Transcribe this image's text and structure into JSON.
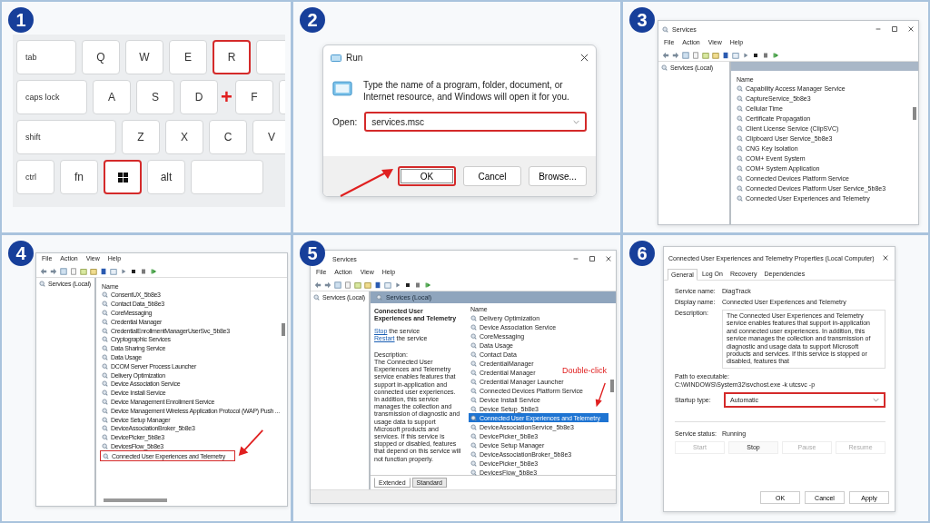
{
  "steps": [
    {
      "number": "1",
      "kind": "keyboard",
      "rows": [
        [
          {
            "label": "tab",
            "kind": "modifier",
            "highlighted": false
          },
          {
            "label": "Q",
            "kind": "letter",
            "highlighted": false
          },
          {
            "label": "W",
            "kind": "letter",
            "highlighted": false
          },
          {
            "label": "E",
            "kind": "letter",
            "highlighted": false
          },
          {
            "label": "R",
            "kind": "letter",
            "highlighted": true
          },
          {
            "kind": "blank",
            "highlighted": false
          }
        ],
        [
          {
            "label": "caps lock",
            "kind": "modifier",
            "highlighted": false
          },
          {
            "label": "A",
            "kind": "letter",
            "highlighted": false
          },
          {
            "label": "S",
            "kind": "letter",
            "highlighted": false
          },
          {
            "label": "D",
            "kind": "letter",
            "highlighted": false
          },
          {
            "label": "+",
            "kind": "plus"
          },
          {
            "label": "F",
            "kind": "letter",
            "highlighted": false
          },
          {
            "kind": "blank",
            "highlighted": false
          }
        ],
        [
          {
            "label": "shift",
            "kind": "modifier",
            "highlighted": false
          },
          {
            "label": "Z",
            "kind": "letter",
            "highlighted": false
          },
          {
            "label": "X",
            "kind": "letter",
            "highlighted": false
          },
          {
            "label": "C",
            "kind": "letter",
            "highlighted": false
          },
          {
            "label": "V",
            "kind": "letter",
            "highlighted": false
          }
        ],
        [
          {
            "label": "ctrl",
            "kind": "modifier",
            "highlighted": false
          },
          {
            "label": "fn",
            "kind": "letter",
            "highlighted": false
          },
          {
            "kind": "windows",
            "highlighted": true
          },
          {
            "label": "alt",
            "kind": "letter",
            "highlighted": false
          },
          {
            "kind": "blank",
            "highlighted": false
          }
        ]
      ]
    },
    {
      "number": "2",
      "kind": "run",
      "title": "Run",
      "prompt": "Type the name of a program, folder, document, or Internet resource, and Windows will open it for you.",
      "open_label": "Open:",
      "value": "services.msc",
      "field_highlighted": true,
      "buttons": [
        {
          "label": "OK",
          "highlighted": true
        },
        {
          "label": "Cancel",
          "highlighted": false
        },
        {
          "label": "Browse...",
          "highlighted": false
        }
      ]
    },
    {
      "number": "3",
      "kind": "services",
      "title": "Services",
      "menu": [
        "File",
        "Action",
        "View",
        "Help"
      ],
      "tree": "Services (Local)",
      "column": "Name",
      "rows": [
        {
          "name": "Capability Access Manager Service",
          "highlighted": false
        },
        {
          "name": "CaptureService_5b8e3",
          "highlighted": false
        },
        {
          "name": "Cellular Time",
          "highlighted": false
        },
        {
          "name": "Certificate Propagation",
          "highlighted": false
        },
        {
          "name": "Client License Service (ClipSVC)",
          "highlighted": false
        },
        {
          "name": "Clipboard User Service_5b8e3",
          "highlighted": false
        },
        {
          "name": "CNG Key Isolation",
          "highlighted": false
        },
        {
          "name": "COM+ Event System",
          "highlighted": false
        },
        {
          "name": "COM+ System Application",
          "highlighted": false
        },
        {
          "name": "Connected Devices Platform Service",
          "highlighted": false
        },
        {
          "name": "Connected Devices Platform User Service_5b8e3",
          "highlighted": false
        },
        {
          "name": "Connected User Experiences and Telemetry",
          "highlighted": false
        }
      ]
    },
    {
      "number": "4",
      "kind": "services",
      "menu": [
        "File",
        "Action",
        "View",
        "Help"
      ],
      "tree": "Services (Local)",
      "column": "Name",
      "rows": [
        {
          "name": "ConsentUX_5b8e3",
          "highlighted": false
        },
        {
          "name": "Contact Data_5b8e3",
          "highlighted": false
        },
        {
          "name": "CoreMessaging",
          "highlighted": false
        },
        {
          "name": "Credential Manager",
          "highlighted": false
        },
        {
          "name": "CredentialEnrollmentManagerUserSvc_5b8e3",
          "highlighted": false
        },
        {
          "name": "Cryptographic Services",
          "highlighted": false
        },
        {
          "name": "Data Sharing Service",
          "highlighted": false
        },
        {
          "name": "Data Usage",
          "highlighted": false
        },
        {
          "name": "DCOM Server Process Launcher",
          "highlighted": false
        },
        {
          "name": "Delivery Optimization",
          "highlighted": false
        },
        {
          "name": "Device Association Service",
          "highlighted": false
        },
        {
          "name": "Device Install Service",
          "highlighted": false
        },
        {
          "name": "Device Management Enrollment Service",
          "highlighted": false
        },
        {
          "name": "Device Management Wireless Application Protocol (WAP) Push ...",
          "highlighted": false
        },
        {
          "name": "Device Setup Manager",
          "highlighted": false
        },
        {
          "name": "DeviceAssociationBroker_5b8e3",
          "highlighted": false
        },
        {
          "name": "DevicePicker_5b8e3",
          "highlighted": false
        },
        {
          "name": "DevicesFlow_5b8e3",
          "highlighted": false
        },
        {
          "name": "Connected User Experiences and Telemetry",
          "highlighted": true
        }
      ]
    },
    {
      "number": "5",
      "kind": "services_detail",
      "title": "Services",
      "menu": [
        "File",
        "Action",
        "View",
        "Help"
      ],
      "tree": "Services (Local)",
      "header": "Services (Local)",
      "service_title": "Connected User Experiences and Telemetry",
      "actions": [
        {
          "link": "Stop",
          "text": "the service"
        },
        {
          "link": "Restart",
          "text": "the service"
        }
      ],
      "description_label": "Description:",
      "description": "The Connected User Experiences and Telemetry service enables features that support in-application and connected user experiences. In addition, this service manages the collection and transmission of diagnostic and usage data to support Microsoft products and services. If this service is stopped or disabled, features that depend on this service will not function properly.",
      "column": "Name",
      "annotation": "Double-click",
      "rows": [
        {
          "name": "Delivery Optimization",
          "selected": false
        },
        {
          "name": "Device Association Service",
          "selected": false
        },
        {
          "name": "CoreMessaging",
          "selected": false
        },
        {
          "name": "Data Usage",
          "selected": false
        },
        {
          "name": "Contact Data",
          "selected": false
        },
        {
          "name": "CredentialManager",
          "selected": false
        },
        {
          "name": "Credential Manager",
          "selected": false
        },
        {
          "name": "Credential Manager Launcher",
          "selected": false
        },
        {
          "name": "Connected Devices Platform Service",
          "selected": false
        },
        {
          "name": "Device Install Service",
          "selected": false
        },
        {
          "name": "Device Setup_5b8e3",
          "selected": false
        },
        {
          "name": "Connected User Experiences and Telemetry",
          "selected": true
        },
        {
          "name": "DeviceAssociationService_5b8e3",
          "selected": false
        },
        {
          "name": "DevicePicker_5b8e3",
          "selected": false
        },
        {
          "name": "Device Setup Manager",
          "selected": false
        },
        {
          "name": "DeviceAssociationBroker_5b8e3",
          "selected": false
        },
        {
          "name": "DevicePicker_5b8e3",
          "selected": false
        },
        {
          "name": "DevicesFlow_5b8e3",
          "selected": false
        }
      ],
      "tabs": [
        {
          "label": "Extended",
          "selected": true
        },
        {
          "label": "Standard",
          "selected": false
        }
      ]
    },
    {
      "number": "6",
      "kind": "properties",
      "title": "Connected User Experiences and Telemetry Properties (Local Computer)",
      "tabs": [
        {
          "label": "General",
          "selected": true
        },
        {
          "label": "Log On",
          "selected": false
        },
        {
          "label": "Recovery",
          "selected": false
        },
        {
          "label": "Dependencies",
          "selected": false
        }
      ],
      "fields": [
        {
          "label": "Service name:",
          "value": "DiagTrack"
        },
        {
          "label": "Display name:",
          "value": "Connected User Experiences and Telemetry"
        }
      ],
      "description_label": "Description:",
      "description": "The Connected User Experiences and Telemetry service enables features that support in-application and connected user experiences. In addition, this service manages the collection and transmission of diagnostic and usage data to support Microsoft products and services. If this service is stopped or disabled, features that",
      "path_label": "Path to executable:",
      "path": "C:\\WINDOWS\\System32\\svchost.exe -k utcsvc -p",
      "startup_label": "Startup type:",
      "startup": "Automatic",
      "startup_highlighted": true,
      "status_label": "Service status:",
      "status": "Running",
      "service_buttons": [
        {
          "label": "Start",
          "disabled": true
        },
        {
          "label": "Stop",
          "disabled": false
        },
        {
          "label": "Pause",
          "disabled": true
        },
        {
          "label": "Resume",
          "disabled": true
        }
      ],
      "buttons": [
        "OK",
        "Cancel",
        "Apply"
      ]
    }
  ]
}
